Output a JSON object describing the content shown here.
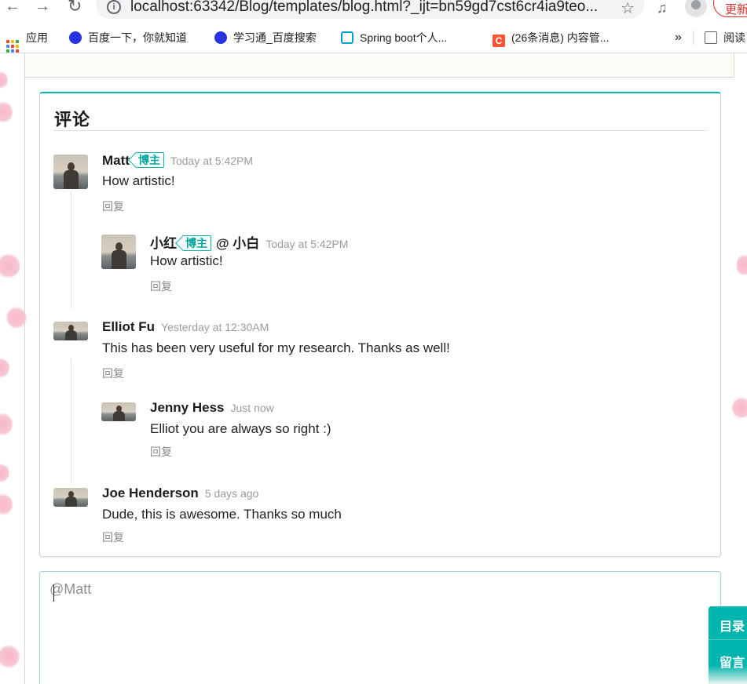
{
  "browser": {
    "back_glyph": "←",
    "forward_glyph": "→",
    "reload_glyph": "↻",
    "info_glyph": "i",
    "url": "localhost:63342/Blog/templates/blog.html?_ijt=bn59gd7cst6cr4ia9teo...",
    "star_glyph": "☆",
    "media_glyph": "♫",
    "update_label": "更新"
  },
  "bookmarks": {
    "items": [
      {
        "label": "应用",
        "icon": "apps-grid-icon"
      },
      {
        "label": "百度一下，你就知道",
        "icon": "baidu-paw-icon"
      },
      {
        "label": "学习通_百度搜索",
        "icon": "baidu-paw-icon"
      },
      {
        "label": "Spring boot个人...",
        "icon": "bilibili-icon"
      },
      {
        "label": "(26条消息) 内容管...",
        "icon": "csdn-icon"
      }
    ],
    "more_glyph": "»",
    "reading_list_label": "阅读"
  },
  "comments": {
    "title": "评论",
    "reply_label": "回复",
    "badge_label": "博主",
    "list": [
      {
        "author": "Matt",
        "badge": true,
        "time": "Today at 5:42PM",
        "text": "How artistic!"
      },
      {
        "author": "小红",
        "badge": true,
        "reply_to": "@ 小白",
        "time": "Today at 5:42PM",
        "text": "How artistic!"
      },
      {
        "author": "Elliot Fu",
        "badge": false,
        "time": "Yesterday at 12:30AM",
        "text": "This has been very useful for my research. Thanks as well!"
      },
      {
        "author": "Jenny Hess",
        "badge": false,
        "time": "Just now",
        "text": "Elliot you are always so right :)"
      },
      {
        "author": "Joe Henderson",
        "badge": false,
        "time": "5 days ago",
        "text": "Dude, this is awesome. Thanks so much"
      }
    ]
  },
  "editor": {
    "placeholder": "@Matt"
  },
  "side_tools": {
    "toc_label": "目录",
    "message_label": "留言"
  },
  "colors": {
    "accent": "#00b5ad",
    "update_red": "#d93025",
    "time_gray": "#9b9b9b"
  }
}
